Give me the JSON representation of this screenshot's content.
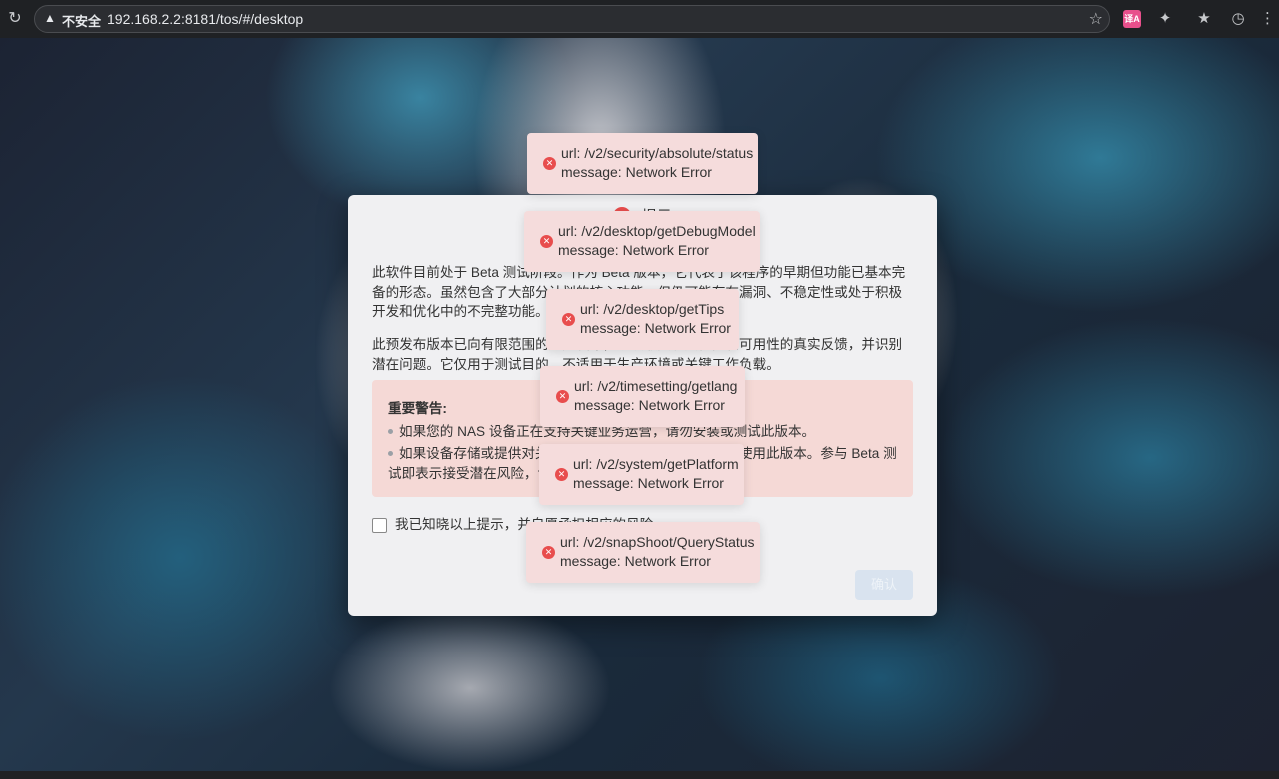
{
  "browser": {
    "insecure_label": "不安全",
    "url": "192.168.2.2:8181/tos/#/desktop",
    "icons": [
      "reload-icon",
      "warning-icon",
      "star-icon",
      "translate-icon",
      "extensions-icon",
      "favorites-icon",
      "history-icon"
    ]
  },
  "dialog": {
    "title": "提示",
    "paragraph1": "此软件目前处于 Beta 测试阶段。作为 Beta 版本，它代表了该程序的早期但功能已基本完备的形态。虽然包含了大部分计划的核心功能，但仍可能存在漏洞、不稳定性或处于积极开发和优化中的不完整功能。",
    "paragraph2": "此预发布版本已向有限范围的用户发布，以获取关于其性能和可用性的真实反馈，并识别潜在问题。它仅用于测试目的，不适用于生产环境或关键工作负载。",
    "warning_title": "重要警告:",
    "warning_item1": "如果您的 NAS 设备正在支持关键业务运营，请勿安装或测试此版本。",
    "warning_item2": "如果设备存储或提供对关键数据的访问，强烈建议您不要使用此版本。参与 Beta 测试即表示接受潜在风险，包括可能的数据丢失。",
    "agree_label": "我已知晓以上提示，并自愿承担相应的风险",
    "confirm_label": "确认"
  },
  "toasts": [
    {
      "url": "url: /v2/security/absolute/status",
      "message": "message: Network Error"
    },
    {
      "url": "url: /v2/desktop/getDebugModel",
      "message": "message: Network Error"
    },
    {
      "url": "url: /v2/desktop/getTips",
      "message": "message: Network Error"
    },
    {
      "url": "url: /v2/timesetting/getlang",
      "message": "message: Network Error"
    },
    {
      "url": "url: /v2/system/getPlatform",
      "message": "message: Network Error"
    },
    {
      "url": "url: /v2/snapShoot/QueryStatus",
      "message": "message: Network Error"
    }
  ],
  "colors": {
    "toast_bg": "#f5dcdc",
    "error_icon": "#e84d4d",
    "dialog_bg": "#f0f0f2",
    "warning_box_bg": "#f5d9d6"
  }
}
